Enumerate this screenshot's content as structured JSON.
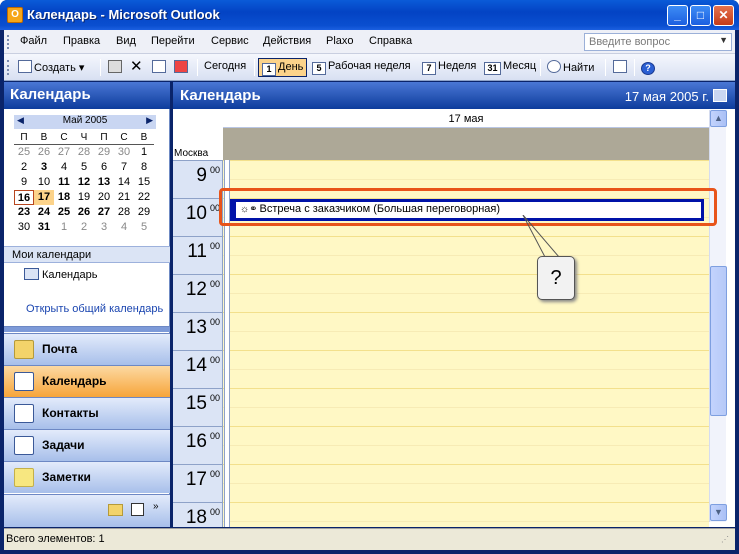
{
  "window": {
    "title": "Календарь - Microsoft Outlook",
    "app_icon_letter": "O",
    "minimize": "_",
    "maximize": "□",
    "close": "✕"
  },
  "menu": {
    "items": [
      "Файл",
      "Правка",
      "Вид",
      "Перейти",
      "Сервис",
      "Действия",
      "Plaxo",
      "Справка"
    ],
    "help_placeholder": "Введите вопрос"
  },
  "toolbar": {
    "create": "Создать",
    "today": "Сегодня",
    "day": "День",
    "work_week": "Рабочая неделя",
    "week": "Неделя",
    "month": "Месяц",
    "find": "Найти",
    "day_icon": "1",
    "work_week_icon": "5",
    "week_icon": "7",
    "month_icon": "31"
  },
  "left_pane": {
    "title": "Календарь",
    "minical": {
      "month": "Май 2005",
      "prev": "◀",
      "next": "▶",
      "dow": [
        "П",
        "В",
        "С",
        "Ч",
        "П",
        "С",
        "В"
      ],
      "weeks": [
        [
          "25",
          "26",
          "27",
          "28",
          "29",
          "30",
          "1"
        ],
        [
          "2",
          "3",
          "4",
          "5",
          "6",
          "7",
          "8"
        ],
        [
          "9",
          "10",
          "11",
          "12",
          "13",
          "14",
          "15"
        ],
        [
          "16",
          "17",
          "18",
          "19",
          "20",
          "21",
          "22"
        ],
        [
          "23",
          "24",
          "25",
          "26",
          "27",
          "28",
          "29"
        ],
        [
          "30",
          "31",
          "1",
          "2",
          "3",
          "4",
          "5"
        ]
      ]
    },
    "my_calendars_title": "Мои календари",
    "calendar_item": "Календарь",
    "open_shared": "Открыть общий календарь",
    "nav": [
      "Почта",
      "Календарь",
      "Контакты",
      "Задачи",
      "Заметки"
    ]
  },
  "main": {
    "title": "Календарь",
    "date": "17 мая 2005 г.",
    "day_header": "17 мая",
    "timezone": "Москва",
    "hours": [
      "9",
      "10",
      "11",
      "12",
      "13",
      "14",
      "15",
      "16",
      "17",
      "18"
    ],
    "minutes": "00",
    "appointment": "Встреча с заказчиком (Большая переговорная)",
    "callout": "?"
  },
  "status": {
    "items_text": "Всего элементов: 1"
  },
  "colors": {
    "accent": "#0a246a",
    "highlight": "#e8541a",
    "slot_bg": "#fff8c5",
    "active_nav": "#f7a53a"
  }
}
